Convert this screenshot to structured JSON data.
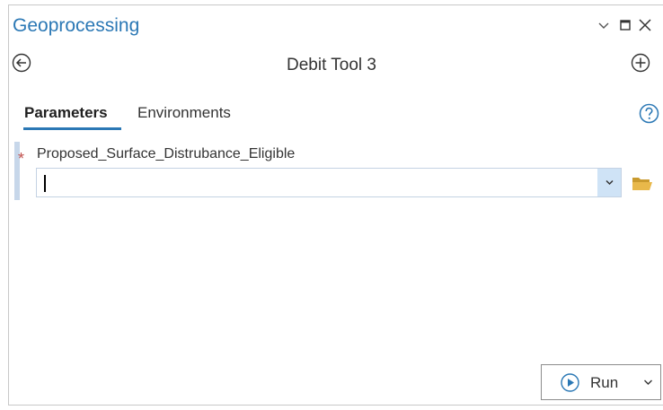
{
  "window": {
    "title": "Geoprocessing",
    "controls": [
      "chevron-down-icon",
      "maximize-icon",
      "close-icon"
    ]
  },
  "tool": {
    "name": "Debit Tool 3"
  },
  "tabs": [
    {
      "label": "Parameters",
      "active": true
    },
    {
      "label": "Environments",
      "active": false
    }
  ],
  "parameter": {
    "required_marker": "*",
    "label": "Proposed_Surface_Distrubance_Eligible",
    "value": ""
  },
  "run_button": {
    "label": "Run"
  },
  "colors": {
    "accent": "#2b78b5",
    "required": "#c0504d",
    "dropdown_bg": "#cfe3f6",
    "folder": "#e8b84a"
  }
}
